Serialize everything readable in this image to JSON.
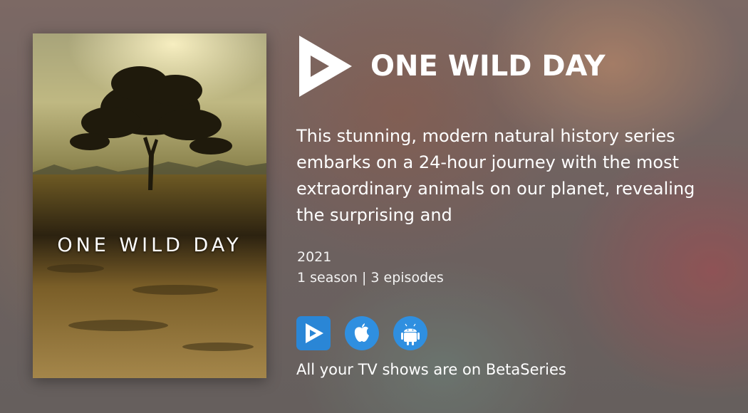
{
  "poster": {
    "title_text": "ONE WILD DAY"
  },
  "header": {
    "logo_icon": "betaseries-play-icon",
    "title": "ONE WILD DAY"
  },
  "show": {
    "description": "This stunning, modern natural history series embarks on a 24-hour journey with the most extraordinary animals on our planet, revealing the surprising and",
    "year": "2021",
    "seasons_episodes": "1 season | 3 episodes"
  },
  "apps": {
    "items": [
      {
        "name": "betaseries-app-icon",
        "color": "#2a86d6"
      },
      {
        "name": "apple-app-store-icon",
        "color": "#2f8fe0"
      },
      {
        "name": "android-app-icon",
        "color": "#2f8fe0"
      }
    ],
    "promo_text": "All your TV shows are on BetaSeries"
  },
  "colors": {
    "text": "#ffffff",
    "app_blue": "#2f8fe0"
  }
}
